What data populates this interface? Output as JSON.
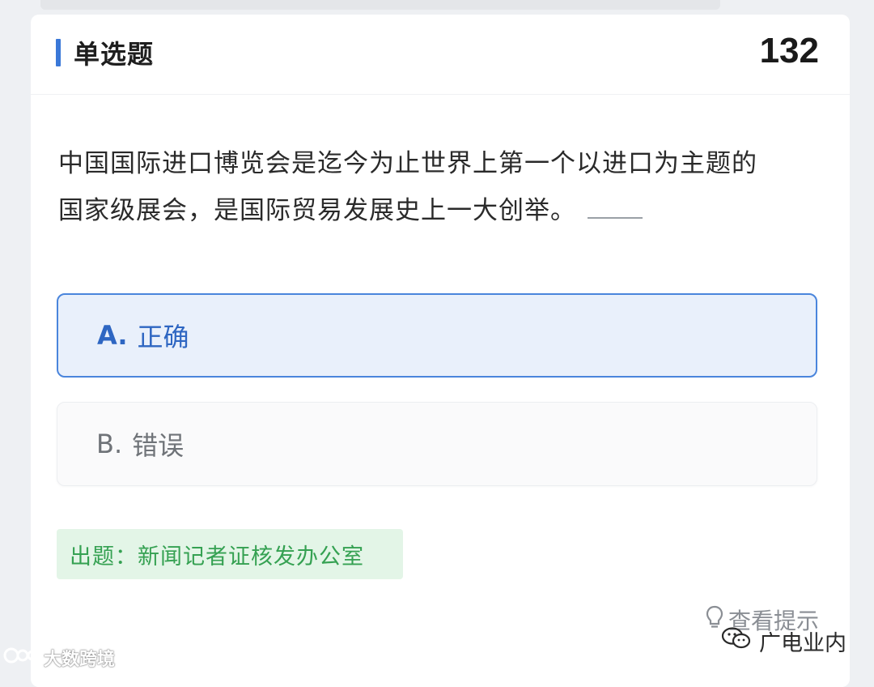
{
  "header": {
    "title": "单选题",
    "number": "132"
  },
  "question": {
    "line1": "中国国际进口博览会是迄今为止世界上第一个以进口为主题的",
    "line2": "国家级展会，是国际贸易发展史上一大创举。"
  },
  "options": [
    {
      "letter": "A.",
      "text": "正确",
      "selected": true
    },
    {
      "letter": "B.",
      "text": "错误",
      "selected": false
    }
  ],
  "source": "出题：新闻记者证核发办公室",
  "hint_label": "查看提示",
  "watermarks": {
    "left": "大数跨境",
    "right": "广电业内"
  },
  "colors": {
    "accent": "#3a78d8",
    "selected_bg": "#e9f0fb",
    "source_green": "#35a152"
  },
  "icons": [
    "lightbulb-icon",
    "wechat-icon",
    "brand-logo-icon"
  ]
}
